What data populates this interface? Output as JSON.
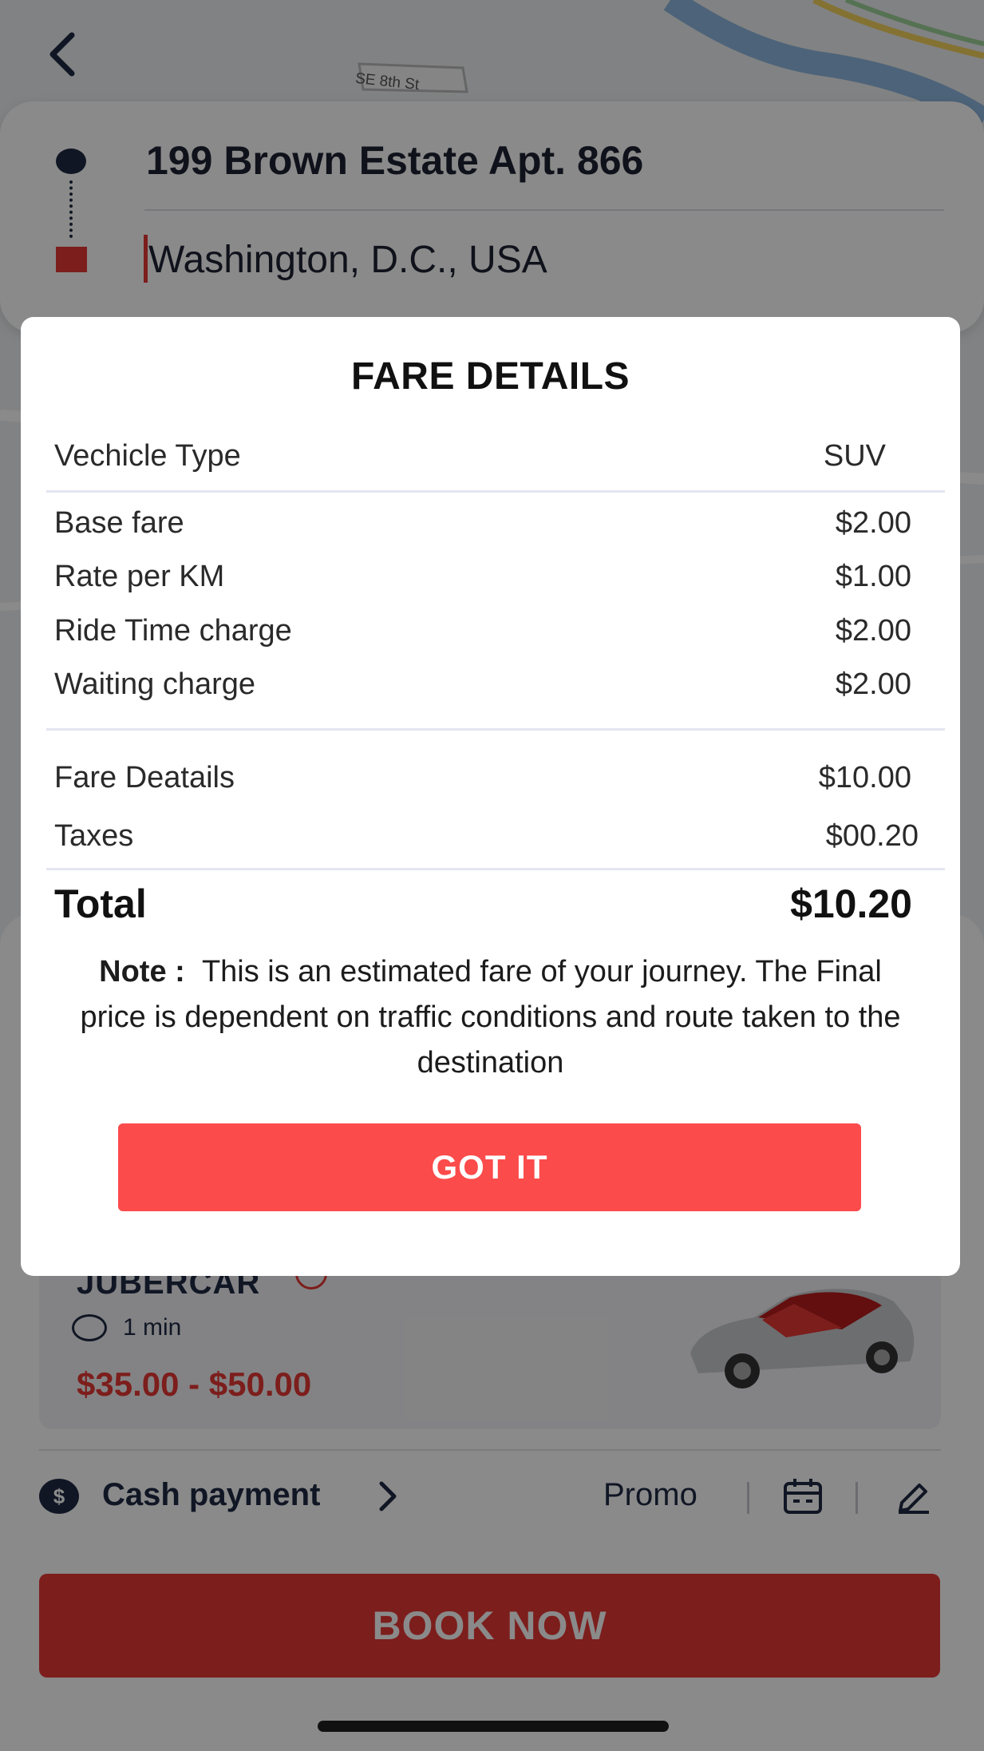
{
  "map": {
    "street_label": "SE 8th St"
  },
  "route": {
    "pickup": "199 Brown Estate Apt. 866",
    "destination": "Washington, D.C., USA"
  },
  "ride_option": {
    "name": "JUBERCAR",
    "eta": "1 min",
    "price_range": "$35.00 - $50.00"
  },
  "payment": {
    "method_label": "Cash payment",
    "currency_symbol": "$",
    "promo_label": "Promo"
  },
  "book_button": "BOOK NOW",
  "fare_modal": {
    "title": "FARE DETAILS",
    "vehicle_type_label": "Vechicle Type",
    "vehicle_type_value": "SUV",
    "charges": [
      {
        "label": "Base fare",
        "value": "$2.00"
      },
      {
        "label": "Rate per KM",
        "value": "$1.00"
      },
      {
        "label": "Ride Time charge",
        "value": "$2.00"
      },
      {
        "label": "Waiting charge",
        "value": "$2.00"
      }
    ],
    "fare_details_label": "Fare Deatails",
    "fare_details_value": "$10.00",
    "taxes_label": "Taxes",
    "taxes_value": "$00.20",
    "total_label": "Total",
    "total_value": "$10.20",
    "note_label": "Note :",
    "note_text": "This is an estimated fare of your journey. The Final price is dependent on traffic conditions and route taken to the destination",
    "button": "GOT IT"
  },
  "icons": {
    "back": "chevron-left-icon",
    "calendar": "calendar-icon",
    "edit": "edit-icon"
  },
  "colors": {
    "accent_red": "#fc4b4b",
    "navy": "#1f2a44"
  }
}
